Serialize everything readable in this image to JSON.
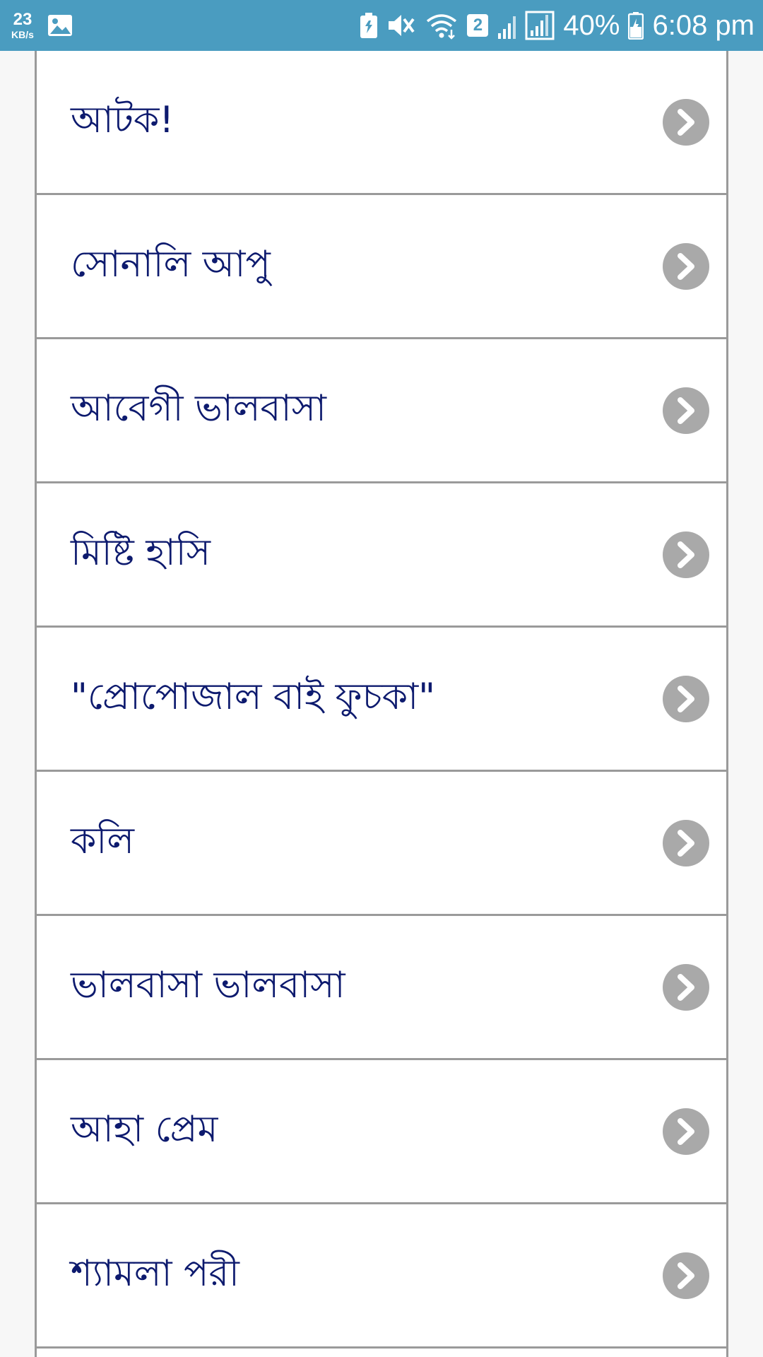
{
  "status_bar": {
    "net_speed_value": "23",
    "net_speed_unit": "KB/s",
    "sim_slot": "2",
    "battery_percent": "40%",
    "time": "6:08 pm",
    "icons": [
      "gallery-icon",
      "battery-saver-icon",
      "mute-icon",
      "wifi-icon",
      "signal-icon",
      "battery-icon"
    ]
  },
  "list": {
    "items": [
      {
        "label": "আটক!"
      },
      {
        "label": "সোনালি আপু"
      },
      {
        "label": "আবেগী ভালবাসা"
      },
      {
        "label": "মিষ্টি হাসি"
      },
      {
        "label": "\"প্রোপোজাল বাই ফুচকা\""
      },
      {
        "label": "কলি"
      },
      {
        "label": "ভালবাসা ভালবাসা"
      },
      {
        "label": "আহা প্রেম"
      },
      {
        "label": "শ্যামলা পরী"
      }
    ]
  },
  "colors": {
    "status_bar": "#4a9cc0",
    "item_text": "#0d1a6e",
    "chevron_bg": "#a9a9a9",
    "divider": "#9a9a9a"
  }
}
